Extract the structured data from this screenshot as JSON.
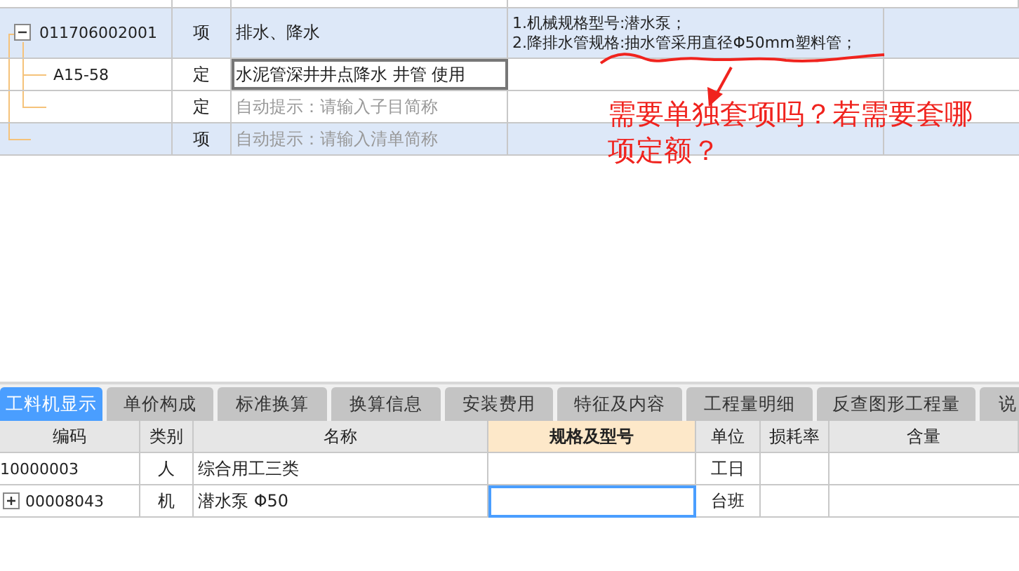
{
  "bill_grid": {
    "rows": [
      {
        "code": "011706002001",
        "type": "项",
        "name": "排水、降水",
        "kind": "bill",
        "expanded": true,
        "editing": false,
        "features": [
          "1.机械规格型号:潜水泵；",
          "2.降排水管规格:抽水管采用直径Φ50mm塑料管；"
        ],
        "children": [
          {
            "code": "A15-58",
            "type": "定",
            "name": "水泥管深井井点降水 井管 使用",
            "kind": "quota",
            "editing": true
          },
          {
            "type": "定",
            "placeholder": "自动提示：请输入子目简称",
            "kind": "quota",
            "editing": false
          }
        ]
      },
      {
        "type": "项",
        "placeholder": "自动提示：请输入清单简称",
        "kind": "bill",
        "editing": false
      }
    ]
  },
  "annotation": {
    "text": "需要单独套项吗？若需要套哪项定额？"
  },
  "detail_tabs": [
    {
      "label": "工料机显示",
      "selected": true
    },
    {
      "label": "单价构成",
      "selected": false
    },
    {
      "label": "标准换算",
      "selected": false
    },
    {
      "label": "换算信息",
      "selected": false
    },
    {
      "label": "安装费用",
      "selected": false
    },
    {
      "label": "特征及内容",
      "selected": false
    },
    {
      "label": "工程量明细",
      "selected": false
    },
    {
      "label": "反查图形工程量",
      "selected": false
    },
    {
      "label": "说",
      "selected": false
    }
  ],
  "detail_table": {
    "columns": [
      {
        "label": "编码",
        "highlighted": false
      },
      {
        "label": "类别",
        "highlighted": false
      },
      {
        "label": "名称",
        "highlighted": false
      },
      {
        "label": "规格及型号",
        "highlighted": true
      },
      {
        "label": "单位",
        "highlighted": false
      },
      {
        "label": "损耗率",
        "highlighted": false
      },
      {
        "label": "含量",
        "highlighted": false
      }
    ],
    "rows": [
      {
        "code": "10000003",
        "category": "人",
        "name": "综合用工三类",
        "unit": "工日",
        "expandable": false,
        "spec_selected": false
      },
      {
        "code": "00008043",
        "category": "机",
        "name": "潜水泵 Φ50",
        "unit": "台班",
        "expandable": true,
        "spec_selected": true
      }
    ]
  }
}
